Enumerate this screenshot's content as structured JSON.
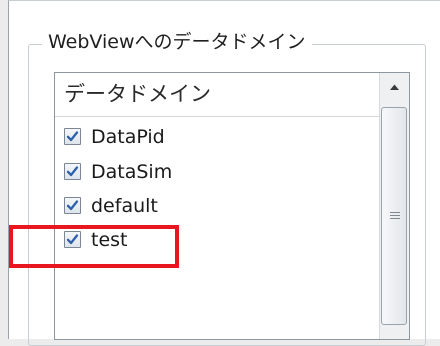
{
  "group": {
    "title": "WebViewへのデータドメイン"
  },
  "list": {
    "header": "データドメイン",
    "items": [
      {
        "label": "DataPid",
        "checked": true
      },
      {
        "label": "DataSim",
        "checked": true
      },
      {
        "label": "default",
        "checked": true
      },
      {
        "label": "test",
        "checked": true
      }
    ]
  },
  "colors": {
    "highlight": "#e8161f",
    "check_mark": "#2f5fa8"
  },
  "icons": {
    "scroll_up": "triangle-up-icon",
    "scroll_grip": "grip-lines-icon",
    "checkbox": "checkmark-icon"
  }
}
